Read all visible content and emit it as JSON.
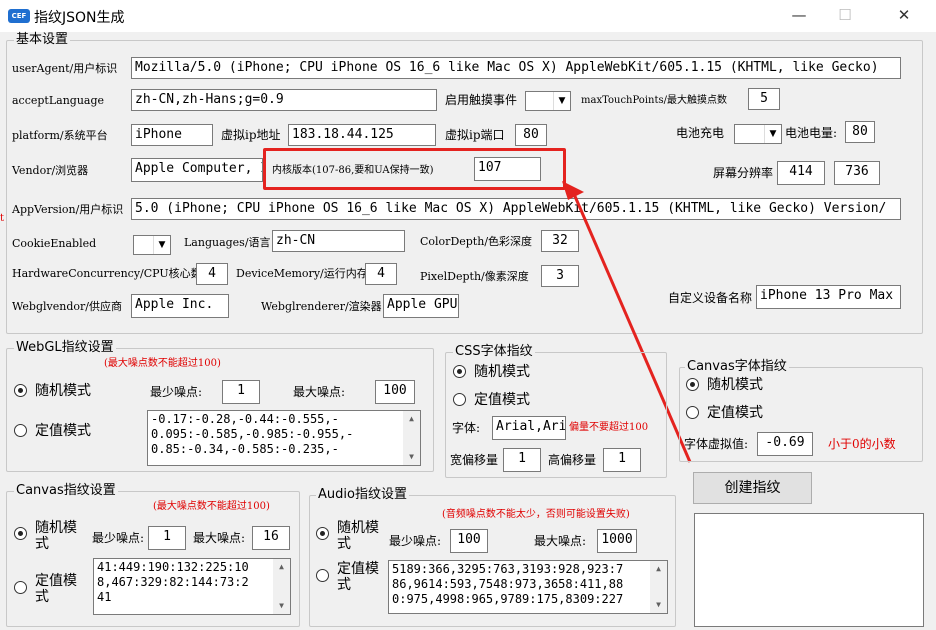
{
  "window": {
    "title": "指纹JSON生成",
    "icon_text": "CEF",
    "minimize": "—",
    "maximize": "☐",
    "close": "✕"
  },
  "basic": {
    "group_title": "基本设置",
    "useragent_label": "userAgent/用户标识",
    "useragent_value": "Mozilla/5.0 (iPhone; CPU iPhone OS 16_6 like Mac OS X) AppleWebKit/605.1.15 (KHTML, like Gecko)",
    "acceptlanguage_label": "acceptLanguage",
    "acceptlanguage_value": "zh-CN,zh-Hans;g=0.9",
    "touch_label": "启用触摸事件",
    "maxtouch_label": "maxTouchPoints/最大触摸点数",
    "maxtouch_value": "5",
    "platform_label": "platform/系统平台",
    "platform_value": "iPhone",
    "vip_label": "虚拟ip地址",
    "vip_value": "183.18.44.125",
    "vport_label": "虚拟ip端口",
    "vport_value": "80",
    "battery_charge_label": "电池充电",
    "battery_level_label": "电池电量:",
    "battery_level_value": "80",
    "vendor_label": "Vendor/浏览器",
    "vendor_value": "Apple Computer, Inc.",
    "kernel_label": "内核版本(107-86,要和UA保持一致)",
    "kernel_value": "107",
    "resolution_label": "屏幕分辨率",
    "resolution_w": "414",
    "resolution_h": "736",
    "appversion_label": "AppVersion/用户标识",
    "appversion_value": "5.0 (iPhone; CPU iPhone OS 16_6 like Mac OS X) AppleWebKit/605.1.15 (KHTML, like Gecko) Version/",
    "cookie_label": "CookieEnabled",
    "languages_label": "Languages/语言",
    "languages_value": "zh-CN",
    "colordepth_label": "ColorDepth/色彩深度",
    "colordepth_value": "32",
    "hwconc_label": "HardwareConcurrency/CPU核心数",
    "hwconc_value": "4",
    "devmem_label": "DeviceMemory/运行内存",
    "devmem_value": "4",
    "pixeldepth_label": "PixelDepth/像素深度",
    "pixeldepth_value": "3",
    "webglvendor_label": "Webglvendor/供应商",
    "webglvendor_value": "Apple Inc.",
    "webglrenderer_label": "Webglrenderer/渲染器",
    "webglrenderer_value": "Apple GPU",
    "device_name_label": "自定义设备名称",
    "device_name_value": "iPhone 13 Pro Max"
  },
  "webgl": {
    "group_title": "WebGL指纹设置",
    "note": "(最大噪点数不能超过100)",
    "random_label": "随机模式",
    "fixed_label": "定值模式",
    "min_label": "最少噪点:",
    "min_value": "1",
    "max_label": "最大噪点:",
    "max_value": "100",
    "fixed_lines": [
      "-0.17:-0.28,-0.44:-0.555,-",
      "0.095:-0.585,-0.985:-0.955,-",
      "0.85:-0.34,-0.585:-0.235,-"
    ]
  },
  "css_font": {
    "group_title": "CSS字体指纹",
    "random_label": "随机模式",
    "fixed_label": "定值模式",
    "font_label": "字体:",
    "font_value": "Arial,Arial Black",
    "note": "偏量不要超过100",
    "width_offset_label": "宽偏移量",
    "width_offset_value": "1",
    "height_offset_label": "高偏移量",
    "height_offset_value": "1"
  },
  "canvas_font": {
    "group_title": "Canvas字体指纹",
    "random_label": "随机模式",
    "fixed_label": "定值模式",
    "virtual_label": "字体虚拟值:",
    "virtual_value": "-0.69",
    "note": "小于0的小数"
  },
  "create_button": "创建指纹",
  "canvas": {
    "group_title": "Canvas指纹设置",
    "note": "(最大噪点数不能超过100)",
    "random_label": "随机模式",
    "fixed_label": "定值模式",
    "min_label": "最少噪点:",
    "min_value": "1",
    "max_label": "最大噪点:",
    "max_value": "16",
    "fixed_lines": [
      "41:449:190:132:225:10",
      "8,467:329:82:144:73:2",
      "41"
    ]
  },
  "audio": {
    "group_title": "Audio指纹设置",
    "note": "(音频噪点数不能太少，否则可能设置失败)",
    "random_label": "随机模式",
    "fixed_label": "定值模式",
    "min_label": "最少噪点:",
    "min_value": "100",
    "max_label": "最大噪点:",
    "max_value": "1000",
    "fixed_lines": [
      "5189:366,3295:763,3193:928,923:7",
      "86,9614:593,7548:973,3658:411,88",
      "0:975,4998:965,9789:175,8309:227"
    ]
  },
  "left_edge_mark": "t",
  "colors": {
    "highlight": "#e4231f",
    "note_red": "#e00000",
    "app_icon": "#1f6fd0"
  }
}
